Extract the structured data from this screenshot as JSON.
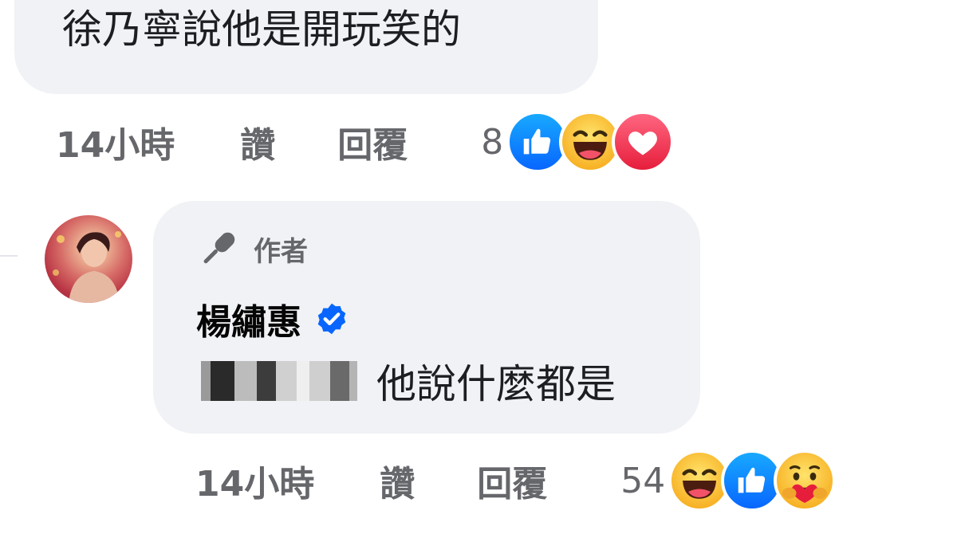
{
  "first_comment": {
    "text": "徐乃寧說他是開玩笑的",
    "time": "14小時",
    "like_label": "讚",
    "reply_label": "回覆",
    "reaction_count": "8",
    "reactions": [
      "like-reaction-icon",
      "haha-reaction-icon",
      "love-reaction-icon"
    ]
  },
  "reply_comment": {
    "author_badge": "作者",
    "author_name": "楊繡惠",
    "text": "他說什麼都是",
    "time": "14小時",
    "like_label": "讚",
    "reply_label": "回覆",
    "reaction_count": "54",
    "reactions": [
      "haha-reaction-icon",
      "like-reaction-icon",
      "care-reaction-icon"
    ]
  },
  "colors": {
    "bubble_bg": "#f0f2f5",
    "meta_text": "#65676b",
    "like_blue": "#0866ff",
    "love_red": "#e61e3c",
    "haha_yellow": "#f7b125",
    "verified_blue": "#0866ff"
  }
}
